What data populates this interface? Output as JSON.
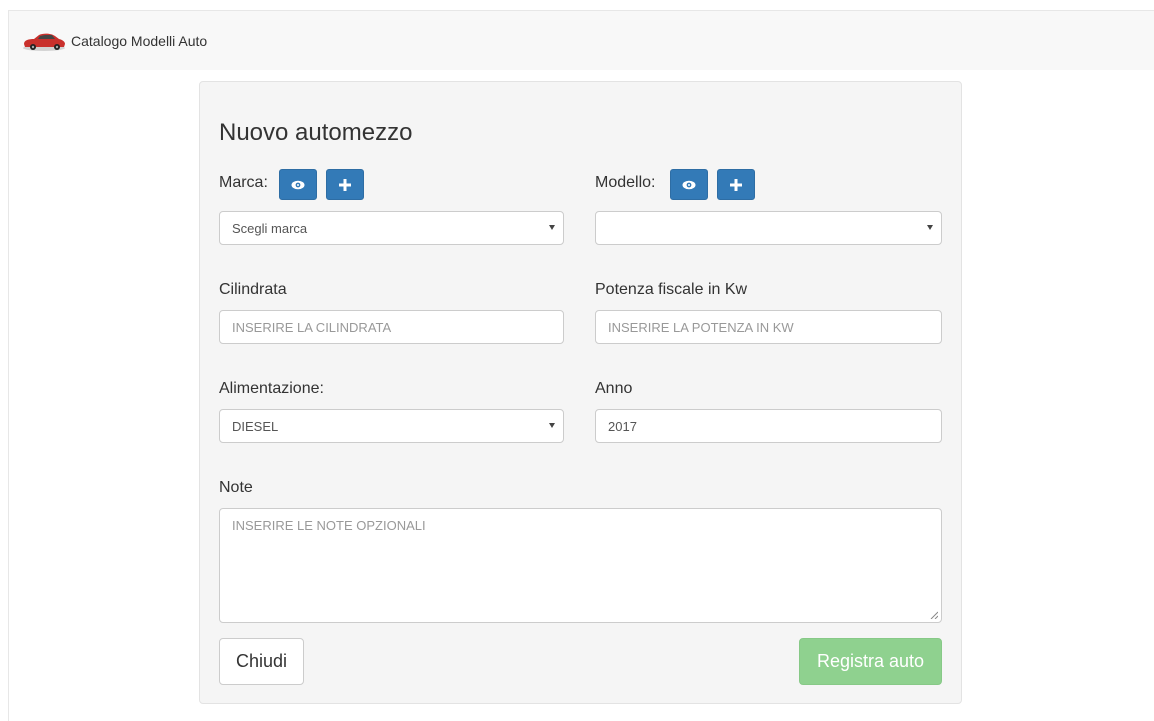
{
  "navbar": {
    "brand_label": "Catalogo Modelli Auto",
    "brand_icon": "car-icon"
  },
  "form": {
    "title": "Nuovo automezzo",
    "marca": {
      "label": "Marca:",
      "view_icon": "eye-icon",
      "add_icon": "plus-icon",
      "selected": "Scegli marca"
    },
    "modello": {
      "label": "Modello:",
      "view_icon": "eye-icon",
      "add_icon": "plus-icon",
      "selected": ""
    },
    "cilindrata": {
      "label": "Cilindrata",
      "placeholder": "INSERIRE LA CILINDRATA",
      "value": ""
    },
    "potenza": {
      "label": "Potenza fiscale in Kw",
      "placeholder": "INSERIRE LA POTENZA IN KW",
      "value": ""
    },
    "alimentazione": {
      "label": "Alimentazione:",
      "selected": "DIESEL"
    },
    "anno": {
      "label": "Anno",
      "value": "2017"
    },
    "note": {
      "label": "Note",
      "placeholder": "INSERIRE LE NOTE OPZIONALI",
      "value": ""
    },
    "buttons": {
      "close_label": "Chiudi",
      "submit_label": "Registra auto"
    }
  },
  "colors": {
    "primary": "#337ab7",
    "success_disabled": "#8fd18f",
    "panel_bg": "#f5f5f5",
    "navbar_bg": "#f8f8f8",
    "brand_car": "#c9302c"
  }
}
